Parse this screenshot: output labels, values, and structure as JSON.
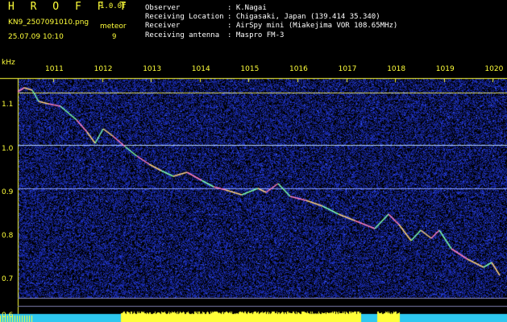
{
  "header": {
    "title": "H R O F F T",
    "version": "1.0.0f",
    "filename": "KN9_2507091010.png",
    "datetime": "25.07.09 10:10",
    "meteor_label": "meteor",
    "meteor_count": "9",
    "fields": [
      {
        "label": "Observer",
        "value": ": K.Nagai"
      },
      {
        "label": "Receiving Location",
        "value": ": Chigasaki, Japan (139.414 35.340)"
      },
      {
        "label": "Receiver",
        "value": ": AirSpy mini (Miakejima VOR 108.65MHz)"
      },
      {
        "label": "Receiving antenna",
        "value": ": Maspro FM-3"
      }
    ]
  },
  "axes": {
    "y_unit": "kHz",
    "y_ticks": [
      "1.1",
      "1.0",
      "0.9",
      "0.8",
      "0.7",
      "0.6"
    ],
    "x_ticks": [
      "1011",
      "1012",
      "1013",
      "1014",
      "1015",
      "1016",
      "1017",
      "1018",
      "1019",
      "1020"
    ]
  },
  "colors": {
    "accent": "#ffff3a",
    "background": "#000000",
    "noise": "#1a2a9a",
    "trace": "#ff7fbf",
    "floor": "#2ec8f0"
  }
}
